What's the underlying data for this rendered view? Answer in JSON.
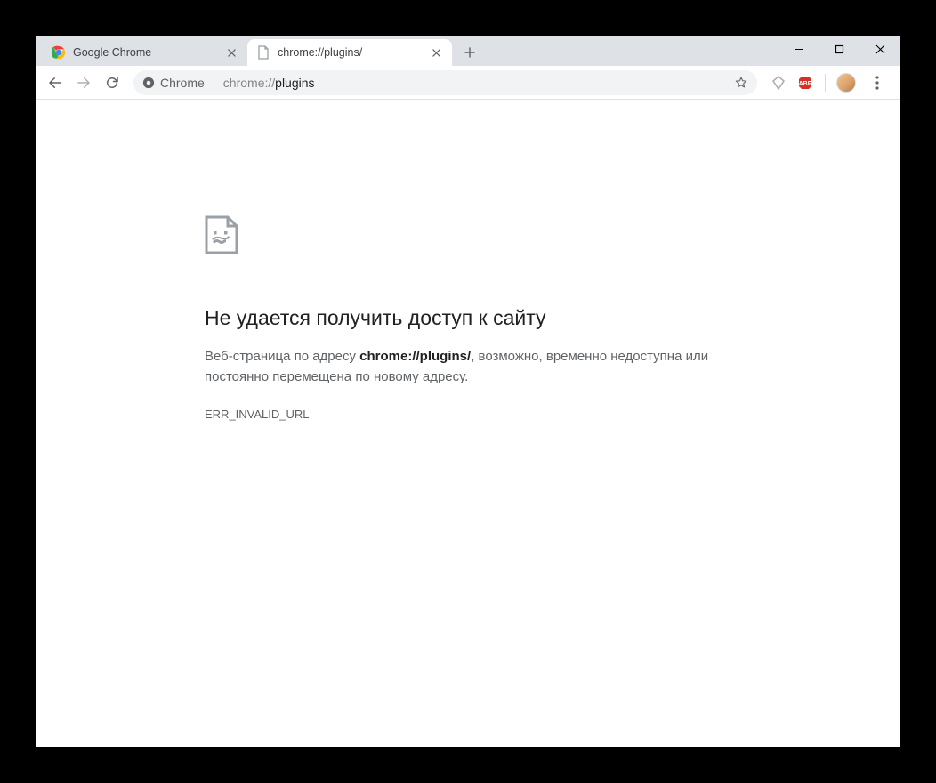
{
  "tabs": [
    {
      "title": "Google Chrome",
      "active": false
    },
    {
      "title": "chrome://plugins/",
      "active": true
    }
  ],
  "omnibox": {
    "chip_label": "Chrome",
    "url_dim": "chrome://",
    "url_bold": "plugins"
  },
  "error": {
    "title": "Не удается получить доступ к сайту",
    "desc_prefix": "Веб-страница по адресу ",
    "desc_url": "chrome://plugins/",
    "desc_suffix": ", возможно, временно недоступна или постоянно перемещена по новому адресу.",
    "code": "ERR_INVALID_URL"
  }
}
